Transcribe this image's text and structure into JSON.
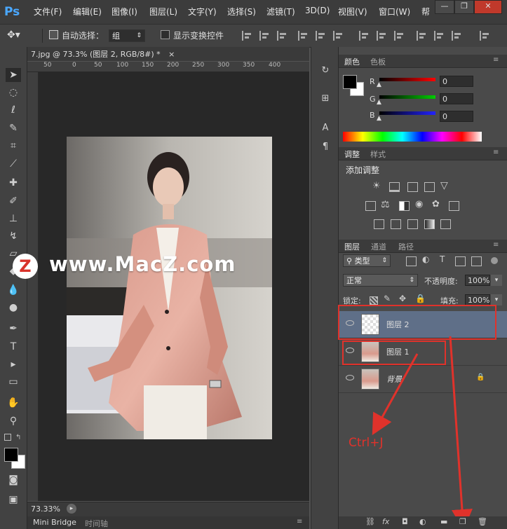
{
  "app": {
    "logo": "Ps"
  },
  "menu": [
    "文件(F)",
    "编辑(E)",
    "图像(I)",
    "图层(L)",
    "文字(Y)",
    "选择(S)",
    "滤镜(T)",
    "3D(D)",
    "视图(V)",
    "窗口(W)",
    "帮"
  ],
  "window_buttons": {
    "minimize": "—",
    "restore": "❐",
    "close": "✕"
  },
  "options": {
    "auto_select_label": "自动选择：",
    "auto_select_value": "组",
    "show_transform_label": "显示变换控件"
  },
  "document": {
    "tab_title": "7.jpg @ 73.3% (图层 2, RGB/8#) *",
    "close_glyph": "×",
    "ruler_ticks": [
      "50",
      "0",
      "50",
      "100",
      "150",
      "200",
      "250",
      "300",
      "350",
      "400"
    ],
    "zoom": "73.33%"
  },
  "bottom_tabs": [
    "Mini Bridge",
    "时间轴"
  ],
  "watermark": {
    "logo_letter": "Z",
    "text": "www.MacZ.com"
  },
  "color_panel": {
    "tabs": [
      "颜色",
      "色板"
    ],
    "channels": [
      {
        "label": "R",
        "value": "0",
        "color": "#ff0000"
      },
      {
        "label": "G",
        "value": "0",
        "color": "#00cc00"
      },
      {
        "label": "B",
        "value": "0",
        "color": "#2222ff"
      }
    ]
  },
  "adjustments_panel": {
    "tabs": [
      "调整",
      "样式"
    ],
    "title": "添加调整"
  },
  "layers_panel": {
    "tabs": [
      "图层",
      "通道",
      "路径"
    ],
    "filter_kind": "类型",
    "blend_mode": "正常",
    "opacity_label": "不透明度:",
    "opacity_value": "100%",
    "lock_label": "锁定:",
    "fill_label": "填充:",
    "fill_value": "100%",
    "layers": [
      {
        "name": "图层 2",
        "selected": true
      },
      {
        "name": "图层 1",
        "selected": false
      },
      {
        "name": "背景",
        "selected": false
      }
    ]
  },
  "annotation": {
    "text": "Ctrl+J",
    "color": "#e0322b"
  }
}
